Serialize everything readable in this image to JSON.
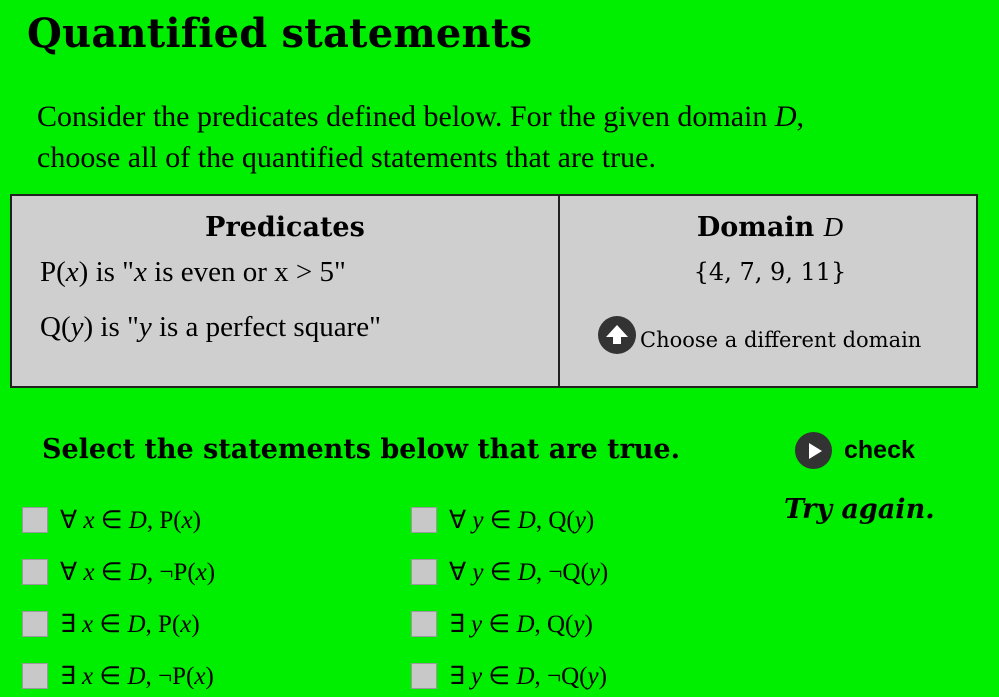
{
  "title": "Quantified statements",
  "intro": {
    "line1_pre": "Consider the predicates defined below.  For the given domain ",
    "line1_var": "D",
    "line1_post": ",",
    "line2": "choose all of the quantified statements that are true."
  },
  "predicates": {
    "heading": "Predicates",
    "p_pre": "P(",
    "p_var": "x",
    "p_mid": ") is \"",
    "p_var2": "x",
    "p_post": " is even or x > 5\"",
    "q_pre": "Q(",
    "q_var": "y",
    "q_mid": ") is \"",
    "q_var2": "y",
    "q_post": " is a perfect square\""
  },
  "domain": {
    "heading": "Domain",
    "heading_var": "D",
    "set": "{4, 7, 9, 11}",
    "change_label": "Choose a different domain"
  },
  "instruction": "Select the statements below that are true.",
  "check_label": "check",
  "feedback": "Try again.",
  "options_left": [
    {
      "q": "∀ ",
      "v": "x",
      "mid": " ∈ ",
      "d": "D",
      "comma": ", ",
      "neg": "",
      "pred": "P(",
      "arg": "x",
      "close": ")"
    },
    {
      "q": "∀ ",
      "v": "x",
      "mid": " ∈ ",
      "d": "D",
      "comma": ", ",
      "neg": "¬",
      "pred": "P(",
      "arg": "x",
      "close": ")"
    },
    {
      "q": "∃ ",
      "v": "x",
      "mid": " ∈ ",
      "d": "D",
      "comma": ", ",
      "neg": "",
      "pred": "P(",
      "arg": "x",
      "close": ")"
    },
    {
      "q": "∃ ",
      "v": "x",
      "mid": " ∈ ",
      "d": "D",
      "comma": ", ",
      "neg": "¬",
      "pred": "P(",
      "arg": "x",
      "close": ")"
    }
  ],
  "options_right": [
    {
      "q": "∀ ",
      "v": "y",
      "mid": " ∈ ",
      "d": "D",
      "comma": ", ",
      "neg": "",
      "pred": "Q(",
      "arg": "y",
      "close": ")"
    },
    {
      "q": "∀ ",
      "v": "y",
      "mid": " ∈ ",
      "d": "D",
      "comma": ", ",
      "neg": "¬",
      "pred": "Q(",
      "arg": "y",
      "close": ")"
    },
    {
      "q": "∃ ",
      "v": "y",
      "mid": " ∈ ",
      "d": "D",
      "comma": ", ",
      "neg": "",
      "pred": "Q(",
      "arg": "y",
      "close": ")"
    },
    {
      "q": "∃ ",
      "v": "y",
      "mid": " ∈ ",
      "d": "D",
      "comma": ", ",
      "neg": "¬",
      "pred": "Q(",
      "arg": "y",
      "close": ")"
    }
  ],
  "colors": {
    "background": "#00ee00",
    "panel": "#cfcfcf",
    "icon": "#333333"
  },
  "icons": {
    "change_domain": "arrow-up-circle-icon",
    "check": "play-circle-icon"
  }
}
